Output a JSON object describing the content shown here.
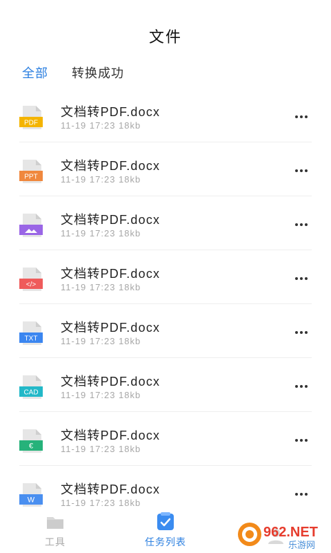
{
  "header": {
    "title": "文件"
  },
  "tabs": [
    {
      "label": "全部",
      "active": true
    },
    {
      "label": "转换成功",
      "active": false
    }
  ],
  "files": [
    {
      "name": "文档转PDF.docx",
      "meta": "11-19 17:23 18kb",
      "type": "PDF",
      "badge": "PDF",
      "color": "#f4b400",
      "icon": "pdf-file-icon"
    },
    {
      "name": "文档转PDF.docx",
      "meta": "11-19 17:23 18kb",
      "type": "PPT",
      "badge": "PPT",
      "color": "#f0883e",
      "icon": "ppt-file-icon"
    },
    {
      "name": "文档转PDF.docx",
      "meta": "11-19 17:23 18kb",
      "type": "IMG",
      "badge": "",
      "color": "#9a66e6",
      "icon": "image-file-icon"
    },
    {
      "name": "文档转PDF.docx",
      "meta": "11-19 17:23 18kb",
      "type": "CODE",
      "badge": "</>",
      "color": "#ef5b5b",
      "icon": "code-file-icon"
    },
    {
      "name": "文档转PDF.docx",
      "meta": "11-19 17:23 18kb",
      "type": "TXT",
      "badge": "TXT",
      "color": "#3b86f0",
      "icon": "txt-file-icon"
    },
    {
      "name": "文档转PDF.docx",
      "meta": "11-19 17:23 18kb",
      "type": "CAD",
      "badge": "CAD",
      "color": "#22b8c8",
      "icon": "cad-file-icon"
    },
    {
      "name": "文档转PDF.docx",
      "meta": "11-19 17:23 18kb",
      "type": "EXCEL",
      "badge": "€",
      "color": "#26b27a",
      "icon": "excel-file-icon"
    },
    {
      "name": "文档转PDF.docx",
      "meta": "11-19 17:23 18kb",
      "type": "WORD",
      "badge": "W",
      "color": "#4a8ff0",
      "icon": "word-file-icon"
    }
  ],
  "tabbar": [
    {
      "label": "工具",
      "active": false,
      "icon": "folder-icon"
    },
    {
      "label": "任务列表",
      "active": true,
      "icon": "task-list-icon"
    },
    {
      "label": "",
      "active": false,
      "icon": "profile-icon"
    }
  ],
  "watermark": {
    "text": "962.NET",
    "subtext": "乐游网"
  }
}
